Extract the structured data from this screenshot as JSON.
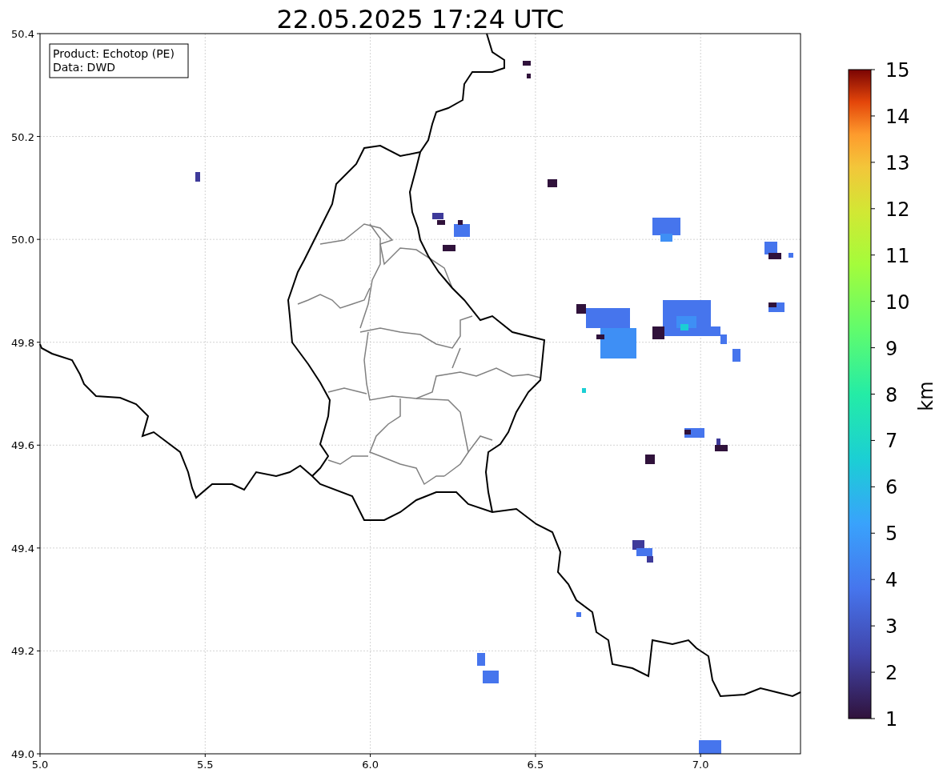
{
  "title": "22.05.2025 17:24 UTC",
  "info_box": [
    "Product: Echotop (PE)",
    "Data: DWD"
  ],
  "x_ticks": [
    "5.0",
    "5.5",
    "6.0",
    "6.5",
    "7.0"
  ],
  "y_ticks": [
    "50.4",
    "50.2",
    "50.0",
    "49.8",
    "49.6",
    "49.4",
    "49.2",
    "49.0"
  ],
  "colorbar": {
    "label": "km",
    "ticks": [
      "15",
      "14",
      "13",
      "12",
      "11",
      "10",
      "9",
      "8",
      "7",
      "6",
      "5",
      "4",
      "3",
      "2",
      "1"
    ]
  }
}
